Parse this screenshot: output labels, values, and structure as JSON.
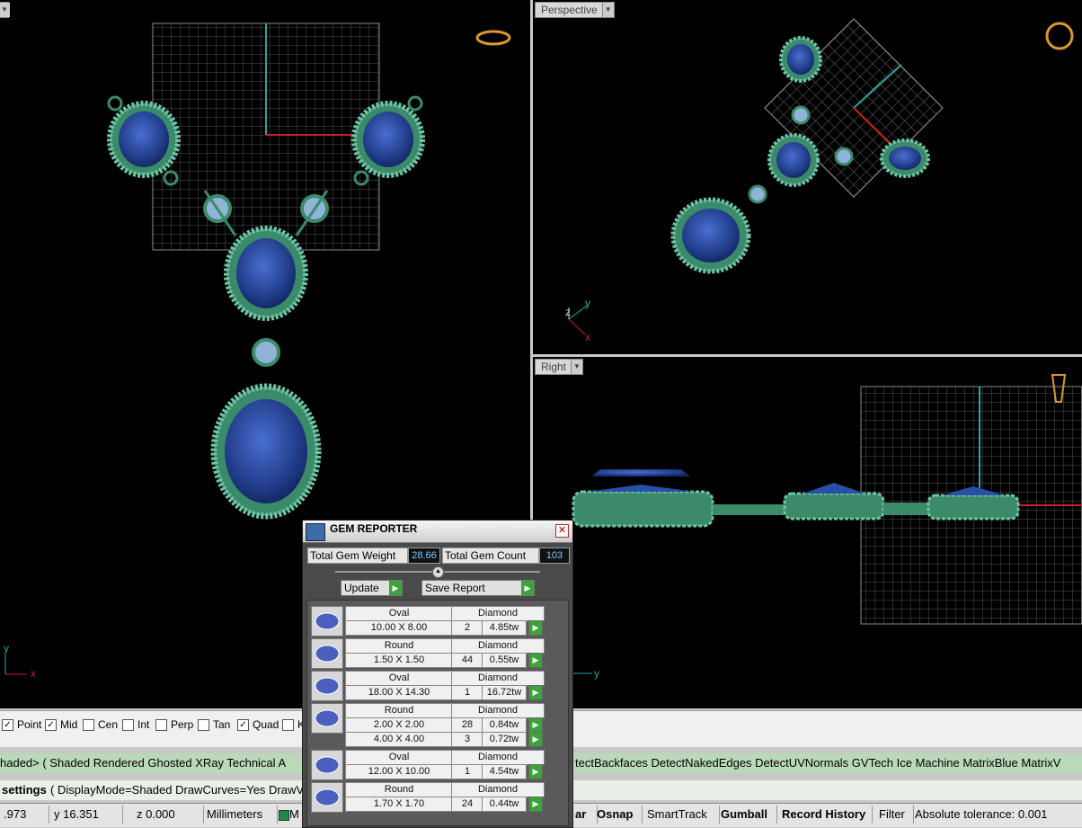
{
  "viewports": {
    "top": {
      "label": ""
    },
    "perspective": {
      "label": "Perspective"
    },
    "right": {
      "label": "Right"
    }
  },
  "osnap": {
    "items": [
      {
        "label": "Point",
        "checked": true
      },
      {
        "label": "Mid",
        "checked": true
      },
      {
        "label": "Cen",
        "checked": false
      },
      {
        "label": "Int",
        "checked": false
      },
      {
        "label": "Perp",
        "checked": false
      },
      {
        "label": "Tan",
        "checked": false
      },
      {
        "label": "Quad",
        "checked": true
      },
      {
        "label": "K",
        "checked": false
      }
    ]
  },
  "display_modes": {
    "left_text": "haded> ( Shaded  Rendered  Ghosted  XRay  Technical  A",
    "right_text": "tectBackfaces  DetectNakedEdges  DetectUVNormals  GVTech  Ice  Machine  MatrixBlue  MatrixV"
  },
  "command": {
    "settings_label": "settings",
    "text": "( DisplayMode=Shaded  DrawCurves=Yes  DrawV"
  },
  "status": {
    "x": ".973",
    "y": "y 16.351",
    "z": "z 0.000",
    "units": "Millimeters",
    "layer": "M",
    "grid_snap": "ar",
    "osnap": "Osnap",
    "smarttrack": "SmartTrack",
    "gumball": "Gumball",
    "record_history": "Record History",
    "filter": "Filter",
    "tolerance": "Absolute tolerance: 0.001"
  },
  "gem_reporter": {
    "title": "GEM REPORTER",
    "total_weight_label": "Total Gem Weight",
    "total_weight": "28.66",
    "total_count_label": "Total Gem Count",
    "total_count": "103",
    "update_label": "Update",
    "save_label": "Save Report",
    "rows": [
      {
        "shape": "Oval",
        "material": "Diamond",
        "sizes": [
          {
            "size": "10.00 X 8.00",
            "count": "2",
            "weight": "4.85tw"
          }
        ]
      },
      {
        "shape": "Round",
        "material": "Diamond",
        "sizes": [
          {
            "size": "1.50 X 1.50",
            "count": "44",
            "weight": "0.55tw"
          }
        ]
      },
      {
        "shape": "Oval",
        "material": "Diamond",
        "sizes": [
          {
            "size": "18.00 X 14.30",
            "count": "1",
            "weight": "16.72tw"
          }
        ]
      },
      {
        "shape": "Round",
        "material": "Diamond",
        "sizes": [
          {
            "size": "2.00 X 2.00",
            "count": "28",
            "weight": "0.84tw"
          },
          {
            "size": "4.00 X 4.00",
            "count": "3",
            "weight": "0.72tw"
          }
        ]
      },
      {
        "shape": "Oval",
        "material": "Diamond",
        "sizes": [
          {
            "size": "12.00 X 10.00",
            "count": "1",
            "weight": "4.54tw"
          }
        ]
      },
      {
        "shape": "Round",
        "material": "Diamond",
        "sizes": [
          {
            "size": "1.70 X 1.70",
            "count": "24",
            "weight": "0.44tw"
          }
        ]
      }
    ]
  },
  "axes": {
    "x": "x",
    "y": "y",
    "z": "z"
  }
}
